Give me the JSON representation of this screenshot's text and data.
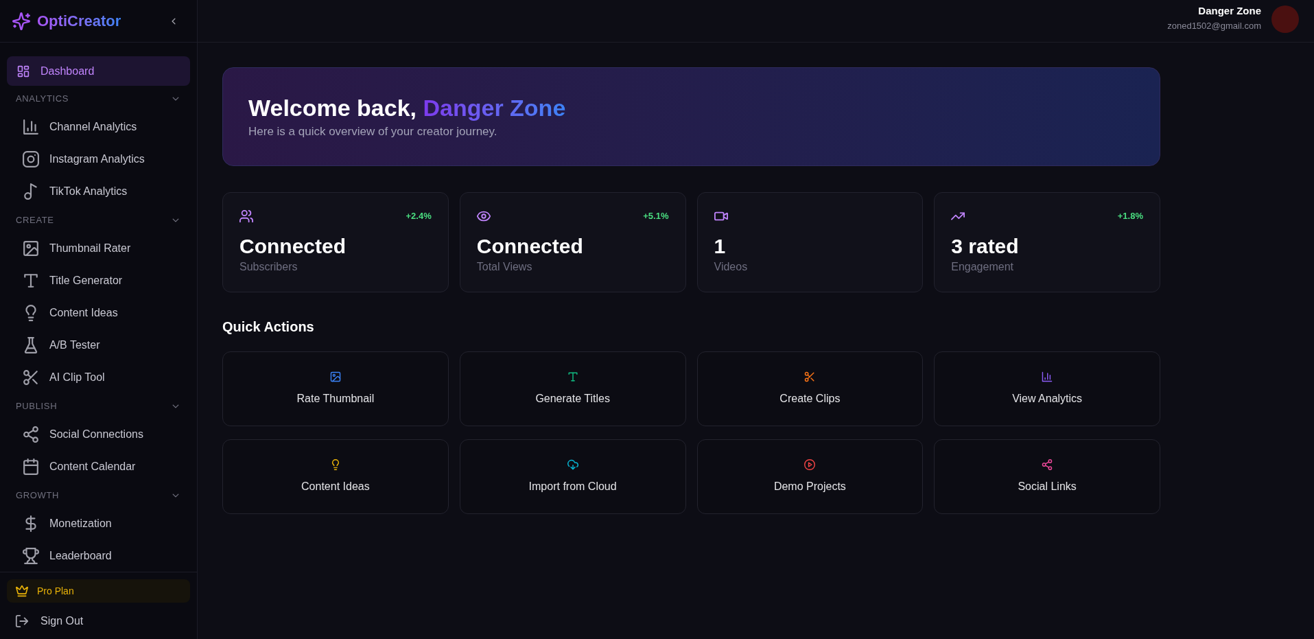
{
  "sidebar": {
    "brand": "OptiCreator",
    "items": [
      {
        "label": "Dashboard",
        "selected": true
      }
    ],
    "sections": [
      {
        "title": "ANALYTICS",
        "expanded": true,
        "items": [
          {
            "label": "Channel Analytics",
            "selected": false
          },
          {
            "label": "Instagram Analytics",
            "selected": false
          },
          {
            "label": "TikTok Analytics",
            "selected": false
          }
        ]
      },
      {
        "title": "CREATE",
        "expanded": true,
        "items": [
          {
            "label": "Thumbnail Rater",
            "selected": false
          },
          {
            "label": "Title Generator",
            "selected": false
          },
          {
            "label": "Content Ideas",
            "selected": false
          },
          {
            "label": "A/B Tester",
            "selected": false
          },
          {
            "label": "AI Clip Tool",
            "selected": false
          }
        ]
      },
      {
        "title": "PUBLISH",
        "expanded": true,
        "items": [
          {
            "label": "Social Connections",
            "selected": false
          },
          {
            "label": "Content Calendar",
            "selected": false
          }
        ]
      },
      {
        "title": "GROWTH",
        "expanded": true,
        "items": [
          {
            "label": "Monetization",
            "selected": false
          },
          {
            "label": "Leaderboard",
            "selected": false
          }
        ]
      }
    ],
    "plan": "Pro Plan",
    "sign_out": "Sign Out"
  },
  "header": {
    "user_name": "Danger Zone",
    "email": "zoned1502@gmail.com"
  },
  "welcome": {
    "greeting": "Welcome back,",
    "name": "Danger Zone",
    "subtitle": "Here is a quick overview of your creator journey."
  },
  "stats": [
    {
      "value": "Connected",
      "label": "Subscribers",
      "change": "+2.4%"
    },
    {
      "value": "Connected",
      "label": "Total Views",
      "change": "+5.1%"
    },
    {
      "value": "1",
      "label": "Videos"
    },
    {
      "value": "3 rated",
      "label": "Engagement",
      "change": "+1.8%"
    }
  ],
  "quick_actions": {
    "title": "Quick Actions",
    "actions": [
      {
        "label": "Rate Thumbnail",
        "color": "#3b82f6"
      },
      {
        "label": "Generate Titles",
        "color": "#10b981"
      },
      {
        "label": "Create Clips",
        "color": "#f97316"
      },
      {
        "label": "View Analytics",
        "color": "#8b5cf6"
      },
      {
        "label": "Content Ideas",
        "color": "#eab308"
      },
      {
        "label": "Import from Cloud",
        "color": "#06b6d4"
      },
      {
        "label": "Demo Projects",
        "color": "#ef4444"
      },
      {
        "label": "Social Links",
        "color": "#ec4899"
      }
    ]
  }
}
